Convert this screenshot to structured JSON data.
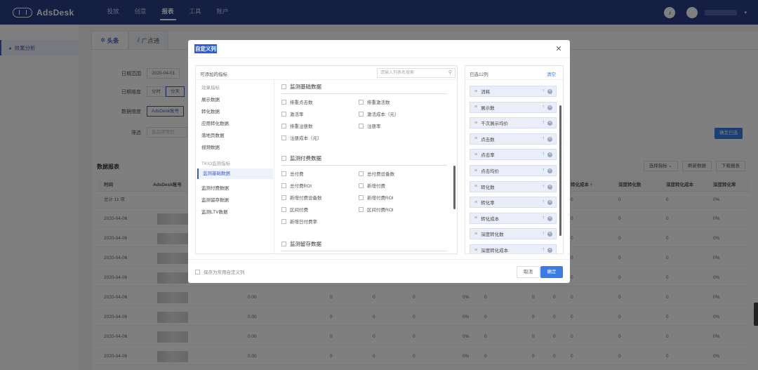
{
  "app": {
    "brand": "AdsDesk"
  },
  "nav": [
    "投放",
    "创意",
    "报表",
    "工具",
    "账户"
  ],
  "nav_active": 2,
  "sidebar": {
    "item": "效果分析"
  },
  "platform_tabs": [
    "头条",
    "广点通"
  ],
  "filters": {
    "date_label": "日期范围",
    "date_value": "2020-04-01",
    "granularity_label": "日期维度",
    "granularity_options": [
      "分时",
      "分天"
    ],
    "dimension_label": "数据维度",
    "dimension_value": "AdsDesk账号",
    "filter_label": "筛选",
    "filter_placeholder": "选品牌项目"
  },
  "apply_button": "确定已选",
  "report": {
    "title": "数据报表",
    "buttons": [
      "选择指标 ⌄",
      "刷新数据",
      "下载报表"
    ],
    "columns": [
      "时间",
      "AdsDesk账号",
      "转化成本 ÷",
      "深度转化数",
      "深度转化成本",
      "深度转化率"
    ],
    "total_label": "总计 11 项",
    "rows": [
      {
        "date": "2020-04-06",
        "v": [
          "0",
          "0",
          "0",
          "0%"
        ]
      },
      {
        "date": "2020-04-06",
        "v": [
          "0",
          "0",
          "0",
          "0%"
        ]
      },
      {
        "date": "2020-04-06",
        "v": [
          "0",
          "0",
          "0",
          "0%"
        ]
      },
      {
        "date": "2020-04-06",
        "v": [
          "0",
          "0",
          "0",
          "0%"
        ]
      },
      {
        "date": "2020-04-06",
        "v": [
          "0",
          "0",
          "0",
          "0%"
        ]
      },
      {
        "date": "2020-04-06",
        "v": [
          "0",
          "0",
          "0",
          "0%"
        ]
      },
      {
        "date": "2020-04-06",
        "v": [
          "0",
          "0",
          "0",
          "0%"
        ]
      },
      {
        "date": "2020-04-06",
        "v": [
          "0",
          "0",
          "0",
          "0%"
        ]
      }
    ],
    "under_modal_vals": [
      "0.00",
      "0",
      "0",
      "0",
      "0%",
      "0",
      "0",
      "0",
      "0%"
    ]
  },
  "modal": {
    "title": "自定义列",
    "left_header": "可添加的指标",
    "search_placeholder": "请输入列表名搜索",
    "categories": [
      {
        "label": "效果指标",
        "type": "group"
      },
      {
        "label": "展示数据",
        "type": "item"
      },
      {
        "label": "转化数据",
        "type": "item"
      },
      {
        "label": "应用转化数据",
        "type": "item"
      },
      {
        "label": "落地页数据",
        "type": "item"
      },
      {
        "label": "视频数据",
        "type": "item"
      },
      {
        "label": "TKIO监测指标",
        "type": "group"
      },
      {
        "label": "监测基础数据",
        "type": "selected"
      },
      {
        "label": "监测付费数据",
        "type": "item"
      },
      {
        "label": "监测留存数据",
        "type": "item"
      },
      {
        "label": "监测LTV数据",
        "type": "item"
      }
    ],
    "sections": [
      {
        "title": "监测基础数据",
        "options": [
          "排重点击数",
          "排重激活数",
          "激活率",
          "激活成本（元）",
          "排重注册数",
          "注册率",
          "注册成本（元）"
        ]
      },
      {
        "title": "监测付费数据",
        "options": [
          "总付费",
          "总付费设备数",
          "总付费ROI",
          "新增付费",
          "新增付费设备数",
          "新增付费ROI",
          "区间付费",
          "区间付费ROI",
          "新增日付费率"
        ]
      },
      {
        "title": "监测留存数据",
        "options": []
      }
    ],
    "right_header": "已选12列",
    "clear_label": "清空",
    "selected": [
      "消耗",
      "展示数",
      "千次展示均价",
      "点击数",
      "点击率",
      "点击均价",
      "转化数",
      "转化率",
      "转化成本",
      "深度转化数",
      "深度转化成本"
    ],
    "save_checkbox": "保存为常用自定义列",
    "cancel": "取消",
    "ok": "确定"
  },
  "icons": {
    "close": "close-icon",
    "search": "search-icon",
    "drag": "drag-handle-icon",
    "up": "arrow-up-icon",
    "remove": "remove-icon"
  }
}
